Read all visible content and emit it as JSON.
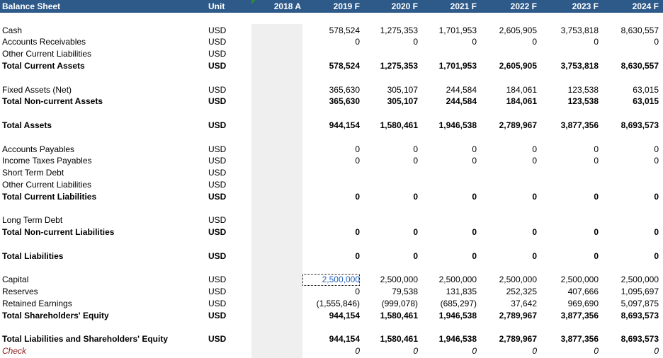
{
  "header": {
    "title": "Balance Sheet",
    "unit": "Unit",
    "years": [
      "2018 A",
      "2019 F",
      "2020 F",
      "2021 F",
      "2022 F",
      "2023 F",
      "2024 F"
    ]
  },
  "rows": [
    {
      "label": "Cash",
      "unit": "USD",
      "total": false,
      "values": [
        "578,524",
        "1,275,353",
        "1,701,953",
        "2,605,905",
        "3,753,818",
        "8,630,557"
      ]
    },
    {
      "label": "Accounts Receivables",
      "unit": "USD",
      "total": false,
      "values": [
        "0",
        "0",
        "0",
        "0",
        "0",
        "0"
      ]
    },
    {
      "label": "Other Current Liabilities",
      "unit": "USD",
      "total": false,
      "values": [
        "",
        "",
        "",
        "",
        "",
        ""
      ]
    },
    {
      "label": "Total Current Assets",
      "unit": "USD",
      "total": true,
      "values": [
        "578,524",
        "1,275,353",
        "1,701,953",
        "2,605,905",
        "3,753,818",
        "8,630,557"
      ]
    },
    {
      "label": "Fixed Assets (Net)",
      "unit": "USD",
      "total": false,
      "values": [
        "365,630",
        "305,107",
        "244,584",
        "184,061",
        "123,538",
        "63,015"
      ]
    },
    {
      "label": "Total Non-current Assets",
      "unit": "USD",
      "total": true,
      "values": [
        "365,630",
        "305,107",
        "244,584",
        "184,061",
        "123,538",
        "63,015"
      ]
    },
    {
      "label": "Total Assets",
      "unit": "USD",
      "total": true,
      "values": [
        "944,154",
        "1,580,461",
        "1,946,538",
        "2,789,967",
        "3,877,356",
        "8,693,573"
      ]
    },
    {
      "label": "Accounts Payables",
      "unit": "USD",
      "total": false,
      "values": [
        "0",
        "0",
        "0",
        "0",
        "0",
        "0"
      ]
    },
    {
      "label": "Income Taxes Payables",
      "unit": "USD",
      "total": false,
      "values": [
        "0",
        "0",
        "0",
        "0",
        "0",
        "0"
      ]
    },
    {
      "label": "Short Term Debt",
      "unit": "USD",
      "total": false,
      "values": [
        "",
        "",
        "",
        "",
        "",
        ""
      ]
    },
    {
      "label": "Other Current Liabilities",
      "unit": "USD",
      "total": false,
      "values": [
        "",
        "",
        "",
        "",
        "",
        ""
      ]
    },
    {
      "label": "Total Current Liabilities",
      "unit": "USD",
      "total": true,
      "values": [
        "0",
        "0",
        "0",
        "0",
        "0",
        "0"
      ]
    },
    {
      "label": "Long Term Debt",
      "unit": "USD",
      "total": false,
      "values": [
        "",
        "",
        "",
        "",
        "",
        ""
      ]
    },
    {
      "label": "Total Non-current Liabilities",
      "unit": "USD",
      "total": true,
      "values": [
        "0",
        "0",
        "0",
        "0",
        "0",
        "0"
      ]
    },
    {
      "label": "Total Liabilities",
      "unit": "USD",
      "total": true,
      "values": [
        "0",
        "0",
        "0",
        "0",
        "0",
        "0"
      ]
    },
    {
      "label": "Capital",
      "unit": "USD",
      "total": false,
      "values": [
        "2,500,000",
        "2,500,000",
        "2,500,000",
        "2,500,000",
        "2,500,000",
        "2,500,000"
      ]
    },
    {
      "label": "Reserves",
      "unit": "USD",
      "total": false,
      "values": [
        "0",
        "79,538",
        "131,835",
        "252,325",
        "407,666",
        "1,095,697"
      ]
    },
    {
      "label": "Retained Earnings",
      "unit": "USD",
      "total": false,
      "values": [
        "(1,555,846)",
        "(999,078)",
        "(685,297)",
        "37,642",
        "969,690",
        "5,097,875"
      ]
    },
    {
      "label": "Total Shareholders' Equity",
      "unit": "USD",
      "total": true,
      "values": [
        "944,154",
        "1,580,461",
        "1,946,538",
        "2,789,967",
        "3,877,356",
        "8,693,573"
      ]
    },
    {
      "label": "Total Liabilities and Shareholders' Equity",
      "unit": "USD",
      "total": true,
      "values": [
        "944,154",
        "1,580,461",
        "1,946,538",
        "2,789,967",
        "3,877,356",
        "8,693,573"
      ]
    },
    {
      "label": "Check",
      "unit": "",
      "total": false,
      "check": true,
      "values": [
        "0",
        "0",
        "0",
        "0",
        "0",
        "0"
      ]
    }
  ],
  "colors": {
    "header_bg": "#2e5a8a",
    "header_text": "#ffffff",
    "selected_column": "#efefef",
    "selected_cell_text": "#1f5fbf",
    "check_label": "#8b1a1a"
  }
}
